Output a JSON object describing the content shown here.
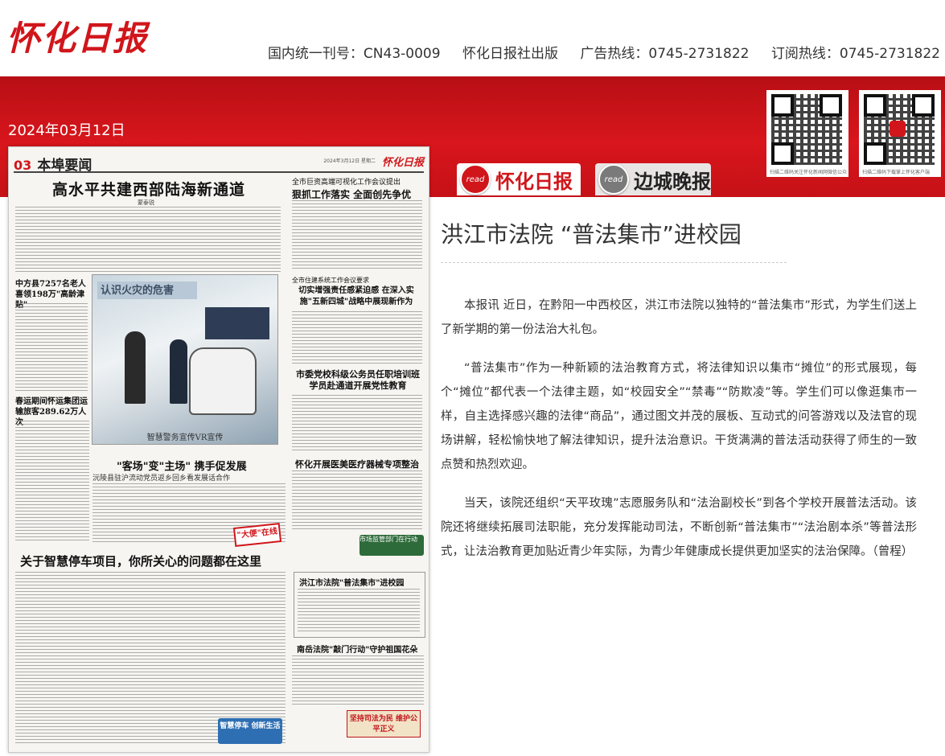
{
  "header": {
    "logo": "怀化日报",
    "issn": "国内统一刊号：CN43-0009",
    "publisher": "怀化日报社出版",
    "ad_hotline": "广告热线：0745-2731822",
    "subscribe_hotline": "订阅热线：0745-2731822"
  },
  "date": "2024年03月12日",
  "qr_codes": [
    {
      "caption": "扫描二维码关注怀化新闻网微信公众号"
    },
    {
      "caption": "扫描二维码下载掌上怀化客户端"
    }
  ],
  "tabs": [
    {
      "icon_text": "read",
      "label": "怀化日报",
      "active": true
    },
    {
      "icon_text": "read",
      "label": "边城晚报",
      "active": false
    }
  ],
  "newspaper": {
    "page_number": "03",
    "section": "本埠要闻",
    "brand": "怀化日报",
    "page_date": "2024年3月12日 星期二",
    "headlines": {
      "main": "高水平共建西部陆海新通道",
      "byline": "蒙泰锐",
      "right_top_kicker": "全市巨资高端可视化工作会议提出",
      "right_top": "狠抓工作落实 全面创先争优",
      "side1": "中方县7257名老人喜领198万\"高龄津贴\"",
      "right_mid_kicker": "全市住建系统工作会议要求",
      "right_mid": "切实增强责任感紧迫感 在深入实施\"五新四城\"战略中展现新作为",
      "photo_banner": "认识火灾的危害",
      "photo_caption": "智慧警务宣传VR宣传",
      "right_mid2": "市委党校科级公务员任职培训班学员赴通道开展党性教育",
      "side2": "春运期间怀运集团运输旅客289.62万人次",
      "center": "\"客场\"变\"主场\" 携手促发展",
      "center_sub": "沅陵县驻沪流动党员返乡回乡看发展话合作",
      "right_mid3": "怀化开展医美医疗器械专项整治",
      "stamp1": "\"大便\"在线",
      "stamp2": "市场监管部门在行动",
      "bottom": "关于智慧停车项目，你所关心的问题都在这里",
      "box_title": "洪江市法院\"普法集市\"进校园",
      "bottom_right": "南岳法院\"敲门行动\"守护祖国花朵",
      "stamp3": "智慧停车 创新生活",
      "stamp4": "坚持司法为民 维护公平正义"
    }
  },
  "article": {
    "title": "洪江市法院 “普法集市”进校园",
    "paragraphs": [
      "本报讯 近日，在黔阳一中西校区，洪江市法院以独特的“普法集市”形式，为学生们送上了新学期的第一份法治大礼包。",
      "“普法集市”作为一种新颖的法治教育方式，将法律知识以集市“摊位”的形式展现，每个“摊位”都代表一个法律主题，如“校园安全”“禁毒”“防欺凌”等。学生们可以像逛集市一样，自主选择感兴趣的法律“商品”，通过图文并茂的展板、互动式的问答游戏以及法官的现场讲解，轻松愉快地了解法律知识，提升法治意识。干货满满的普法活动获得了师生的一致点赞和热烈欢迎。",
      "当天，该院还组织“天平玫瑰”志愿服务队和“法治副校长”到各个学校开展普法活动。该院还将继续拓展司法职能，充分发挥能动司法，不断创新“普法集市”“法治剧本杀”等普法形式，让法治教育更加贴近青少年实际，为青少年健康成长提供更加坚实的法治保障。（曾程）"
    ]
  }
}
